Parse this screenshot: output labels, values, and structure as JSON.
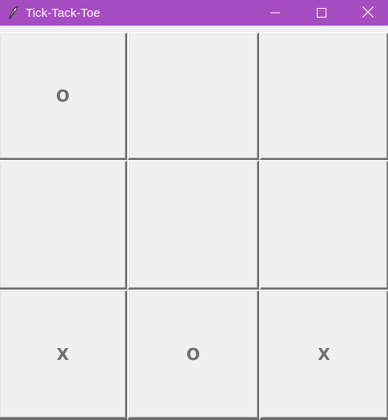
{
  "window": {
    "title": "Tick-Tack-Toe",
    "icon": "feather-icon",
    "titlebar_color": "#a64cc1",
    "controls": {
      "minimize_icon": "minimize-icon",
      "maximize_icon": "maximize-icon",
      "close_icon": "close-icon"
    }
  },
  "board": {
    "cells": [
      [
        "O",
        "",
        ""
      ],
      [
        "",
        "",
        ""
      ],
      [
        "X",
        "O",
        "X"
      ]
    ]
  }
}
